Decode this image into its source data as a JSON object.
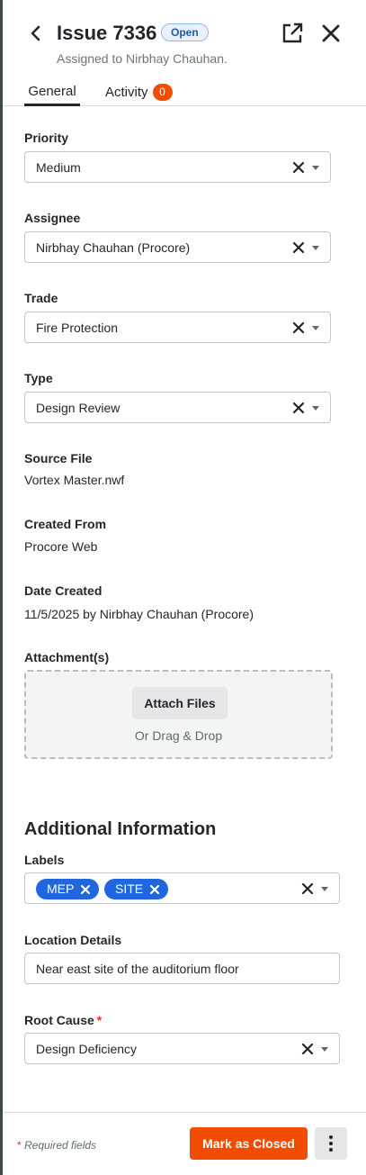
{
  "header": {
    "title": "Issue 7336",
    "status": "Open",
    "subtitle": "Assigned to Nirbhay Chauhan."
  },
  "tabs": [
    {
      "label": "General"
    },
    {
      "label": "Activity",
      "count": "0"
    }
  ],
  "fields": {
    "priority": {
      "label": "Priority",
      "value": "Medium"
    },
    "assignee": {
      "label": "Assignee",
      "value": "Nirbhay Chauhan (Procore)"
    },
    "trade": {
      "label": "Trade",
      "value": "Fire Protection"
    },
    "type": {
      "label": "Type",
      "value": "Design Review"
    },
    "source_file": {
      "label": "Source File",
      "value": "Vortex Master.nwf"
    },
    "created_from": {
      "label": "Created From",
      "value": "Procore Web"
    },
    "date_created": {
      "label": "Date Created",
      "value": "11/5/2025 by Nirbhay Chauhan (Procore)"
    },
    "attachments": {
      "label": "Attachment(s)",
      "button": "Attach Files",
      "hint": "Or Drag & Drop"
    }
  },
  "additional": {
    "title": "Additional Information",
    "labels": {
      "label": "Labels",
      "chips": [
        "MEP",
        "SITE"
      ]
    },
    "location_details": {
      "label": "Location Details",
      "value": "Near east site of the auditorium floor"
    },
    "root_cause": {
      "label": "Root Cause",
      "required_mark": "*",
      "value": "Design Deficiency"
    }
  },
  "footer": {
    "required_mark": "*",
    "required_note": "Required fields",
    "primary_button": "Mark as Closed"
  },
  "icons": {
    "back": "chevron-left-icon",
    "open_external": "external-link-icon",
    "close": "close-icon",
    "clear": "clear-x-icon",
    "caret": "caret-down-icon",
    "more": "more-vertical-icon"
  },
  "colors": {
    "accent": "#f24c00",
    "chip": "#2066df",
    "status_badge_bg": "#e8f0fc",
    "status_badge_text": "#2457a6",
    "required": "#e03a1f"
  }
}
